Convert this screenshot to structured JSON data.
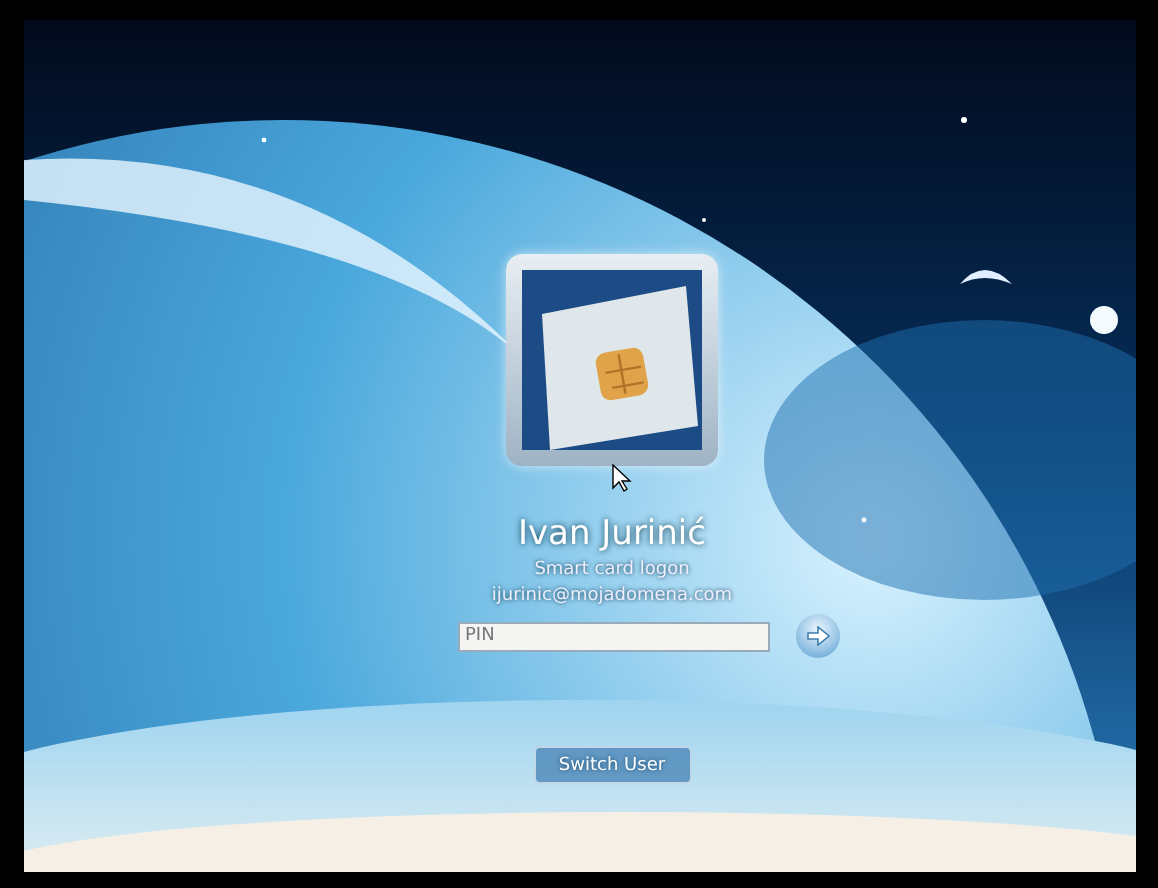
{
  "user": {
    "name": "Ivan Jurinić",
    "logon_method": "Smart card logon",
    "email": "ijurinic@mojadomena.com"
  },
  "pin_field": {
    "placeholder": "PIN"
  },
  "switch_user_button": "Switch User"
}
